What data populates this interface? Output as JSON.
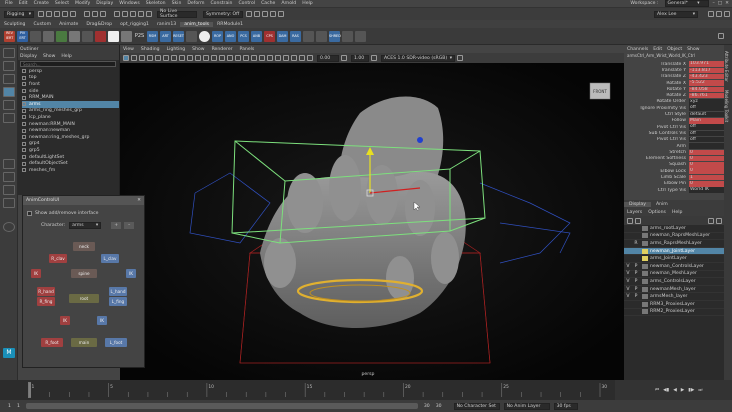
{
  "menubar": {
    "items": [
      "File",
      "Edit",
      "Create",
      "Select",
      "Modify",
      "Display",
      "Windows",
      "Skeleton",
      "Skin",
      "Deform",
      "Constrain",
      "Control",
      "Cache",
      "Arnold",
      "Help"
    ],
    "workspace_label": "Workspace :",
    "workspace_value": "General*"
  },
  "toolbar": {
    "mode": "Rigging",
    "live_surface": "No Live Surface",
    "symmetry": "Symmetry: Off",
    "user": "Alex Lee"
  },
  "shelf": {
    "tabs": [
      "Sculpting",
      "Custom",
      "Animate",
      "Drag&Drop",
      "opt_rigging1",
      "ranim13",
      "anim_tools",
      "RRModule1"
    ],
    "active_tab": "anim_tools",
    "buttons": [
      "REV IERT",
      "PIV ERT",
      "P2S",
      "RSM",
      "ART",
      "RESET",
      "ROP",
      "ANO",
      "PCS",
      "ANB",
      "CPS",
      "DAM",
      "RAS",
      "SHRED",
      "LAYER"
    ]
  },
  "outliner": {
    "title": "Outliner",
    "menu": [
      "Display",
      "Show",
      "Help"
    ],
    "search_placeholder": "Search...",
    "items": [
      "persp",
      "top",
      "front",
      "side",
      "RRM_MAIN",
      "arms",
      "arms_ring_meshes_grp",
      "lcp_plane",
      "newman:RRM_MAIN",
      "newman:newman",
      "newman:ring_meshes_grp",
      "grp4",
      "grp5",
      "defaultLightSet",
      "defaultObjectSet",
      "meshes_fm"
    ],
    "selected": "arms"
  },
  "viewport": {
    "menu": [
      "View",
      "Shading",
      "Lighting",
      "Show",
      "Renderer",
      "Panels"
    ],
    "field1": "0.00",
    "field2": "1.00",
    "colorspace": "ACES 1.0 SDR-video (sRGB)",
    "camera_label": "persp",
    "cube_label": "FRONT"
  },
  "channelbox": {
    "tabs": [
      "Channels",
      "Edit",
      "Object",
      "Show"
    ],
    "object": "armsCtrl_Arm_Wrist_World_IK_Ctrl",
    "rows": [
      {
        "name": "Translate X",
        "value": "103.971",
        "keyed": true
      },
      {
        "name": "Translate Y",
        "value": "-113.817",
        "keyed": true
      },
      {
        "name": "Translate Z",
        "value": "-43.423",
        "keyed": true
      },
      {
        "name": "Rotate X",
        "value": "-5.522",
        "keyed": true
      },
      {
        "name": "Rotate Y",
        "value": "-84.058",
        "keyed": true
      },
      {
        "name": "Rotate Z",
        "value": "-86.761",
        "keyed": true
      },
      {
        "name": "Rotate Order",
        "value": "xyz",
        "keyed": false
      },
      {
        "name": "Ignore Proximity Vis",
        "value": "off",
        "keyed": false
      },
      {
        "name": "Ctrl Style",
        "value": "default",
        "keyed": false
      },
      {
        "name": "Follow",
        "value": "Main",
        "keyed": true
      },
      {
        "name": "Pivot Ctrl Vis",
        "value": "off",
        "keyed": false
      },
      {
        "name": "Sub Controls Vis",
        "value": "off",
        "keyed": false
      },
      {
        "name": "Pivot Ctrl Vis",
        "value": "off",
        "keyed": false
      },
      {
        "name": "Arm",
        "value": "",
        "keyed": false
      },
      {
        "name": "Stretch",
        "value": "0",
        "keyed": true
      },
      {
        "name": "Element Softness",
        "value": "0",
        "keyed": true
      },
      {
        "name": "Squash",
        "value": "0",
        "keyed": true
      },
      {
        "name": "Elbow Lock",
        "value": "0",
        "keyed": true
      },
      {
        "name": "Limb Scale",
        "value": "1",
        "keyed": true
      },
      {
        "name": "Elbow Pin",
        "value": "0",
        "keyed": true
      },
      {
        "name": "Ctrl Type Vis",
        "value": "World IK",
        "keyed": false
      }
    ]
  },
  "layers": {
    "tabs": [
      "Display",
      "Anim"
    ],
    "menu": [
      "Layers",
      "Options",
      "Help"
    ],
    "rows": [
      {
        "v": "",
        "p": "",
        "name": "arms_rootLayer",
        "color": "#777777"
      },
      {
        "v": "",
        "p": "",
        "name": "newman_RaprsMeshLayer",
        "color": "#777777"
      },
      {
        "v": "",
        "p": "R",
        "name": "arms_RaprsMeshLayer",
        "color": "#777777"
      },
      {
        "v": "",
        "p": "",
        "name": "newman_JointLayer",
        "color": "#e0d060",
        "hl": true
      },
      {
        "v": "",
        "p": "",
        "name": "arms_JointLayer",
        "color": "#e0d060"
      },
      {
        "v": "V",
        "p": "P",
        "name": "newman_ControlsLayer",
        "color": "#777777"
      },
      {
        "v": "V",
        "p": "P",
        "name": "newman_MeshLayer",
        "color": "#777777"
      },
      {
        "v": "V",
        "p": "P",
        "name": "arms_ControlsLayer",
        "color": "#777777"
      },
      {
        "v": "V",
        "p": "P",
        "name": "newmanMesh_layer",
        "color": "#777777"
      },
      {
        "v": "V",
        "p": "P",
        "name": "armsMesh_layer",
        "color": "#777777"
      },
      {
        "v": "",
        "p": "",
        "name": "RRM3_ProxiesLayer",
        "color": "#777777"
      },
      {
        "v": "",
        "p": "",
        "name": "RRM2_ProxiesLayer",
        "color": "#777777"
      }
    ]
  },
  "sidetabs": [
    "Attribute Editor",
    "Modeling Toolkit"
  ],
  "dialog": {
    "title": "AnimControlUI",
    "checkbox_label": "Show add/remove interface",
    "character_label": "Character:",
    "character_value": "arms",
    "buttons": {
      "neck": "neck",
      "l_clav": "R_clav",
      "r_clav": "L_clav",
      "l_arm": "IK",
      "spine": "spine",
      "r_arm": "IK",
      "l_hand": "R_hand",
      "l_fing": "R_fing",
      "root": "root",
      "r_hand": "L_hand",
      "r_fing": "L_fing",
      "l_leg": "IK",
      "r_leg": "IK",
      "l_foot": "R_foot",
      "main": "main",
      "r_foot": "L_foot"
    }
  },
  "timeline": {
    "ticks": [
      "1",
      "5",
      "10",
      "15",
      "20",
      "25",
      "30"
    ],
    "current_frame": "1",
    "end_frame": "30"
  },
  "rangebar": {
    "start": "1",
    "start2": "1",
    "end": "30",
    "end2": "30",
    "character_set": "No Character Set",
    "anim_layer": "No Anim Layer",
    "fps": "30 fps"
  },
  "colors": {
    "selection": "#5285a6",
    "keyed": "#c24a4a",
    "bbox": "#7de07d",
    "mesh": "#8a8a8a"
  }
}
